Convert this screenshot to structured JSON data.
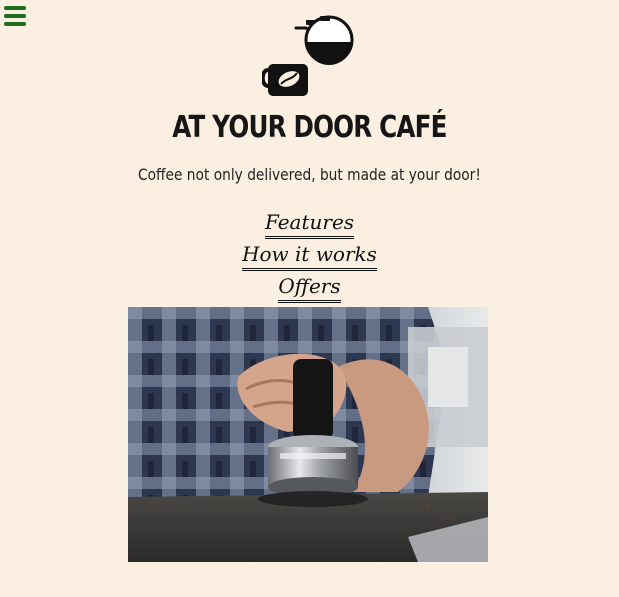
{
  "header": {
    "menu_icon": "hamburger-menu-icon",
    "logo_icon": "coffee-pot-and-mug-logo",
    "brand_name": "AT YOUR DOOR CAFÉ",
    "tagline": "Coffee not only delivered, but made at your door!"
  },
  "nav": {
    "items": [
      {
        "label": "Features"
      },
      {
        "label": "How it works"
      },
      {
        "label": "Offers"
      }
    ]
  },
  "hero": {
    "image_icon": "barista-tamping-coffee-photo"
  },
  "colors": {
    "background": "#faefe0",
    "menu_icon": "#1d6b1d",
    "text": "#161616"
  }
}
